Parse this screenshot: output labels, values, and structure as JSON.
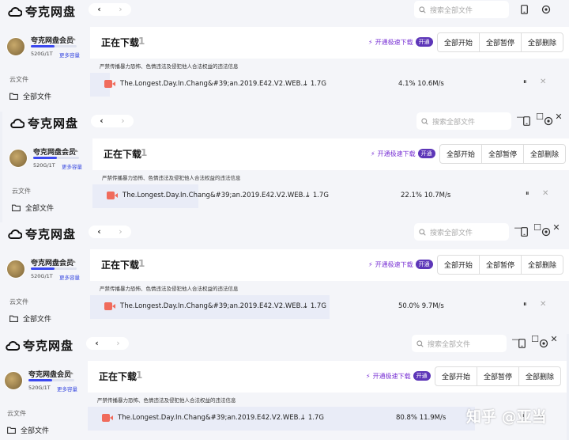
{
  "app": {
    "logo_text": "夸克网盘",
    "search_placeholder": "搜索全部文件",
    "member_name": "夸克网盘会员",
    "storage_text": "520G/1T",
    "storage_used_fraction": 0.52,
    "more_capacity_label": "更多容量",
    "section_label": "云文件",
    "all_files_label": "全部文件",
    "page_title": "正在下载",
    "download_count": "1",
    "speed_promo_label": "开通极速下载",
    "open_badge_label": "开通",
    "action_labels": [
      "全部开始",
      "全部暂停",
      "全部删除"
    ],
    "warning_text": "严禁传播暴力恐怖、色情违法及侵犯他人合法权益的违法信息",
    "file_name": "The.Longest.Day.In.Chang&#39;an.2019.E42.V2.WEB...",
    "file_size": "↓ 1.7G",
    "icons": [
      "cloud-logo-icon",
      "back-arrow-icon",
      "forward-arrow-icon",
      "search-icon",
      "phone-icon",
      "settings-icon",
      "folder-icon",
      "file-video-icon",
      "lightning-icon",
      "pause-icon",
      "close-icon",
      "minimize-icon",
      "maximize-icon"
    ],
    "accent_color": "#3c49ef",
    "promo_color": "#7a33d4"
  },
  "snapshots": [
    {
      "progress_text": "4.1% 10.6M/s",
      "progress_fraction": 0.041,
      "window_controls": [
        "",
        "",
        ""
      ]
    },
    {
      "progress_text": "22.1% 10.7M/s",
      "progress_fraction": 0.221,
      "window_controls": [
        "—",
        "☐",
        "✕"
      ]
    },
    {
      "progress_text": "50.0% 9.7M/s",
      "progress_fraction": 0.5,
      "window_controls": [
        "—",
        "☐",
        "✕"
      ]
    },
    {
      "progress_text": "80.8% 11.9M/s",
      "progress_fraction": 0.808,
      "window_controls": [
        "—",
        "☐",
        "✕"
      ]
    }
  ],
  "watermark_text": "知乎 @亚当"
}
